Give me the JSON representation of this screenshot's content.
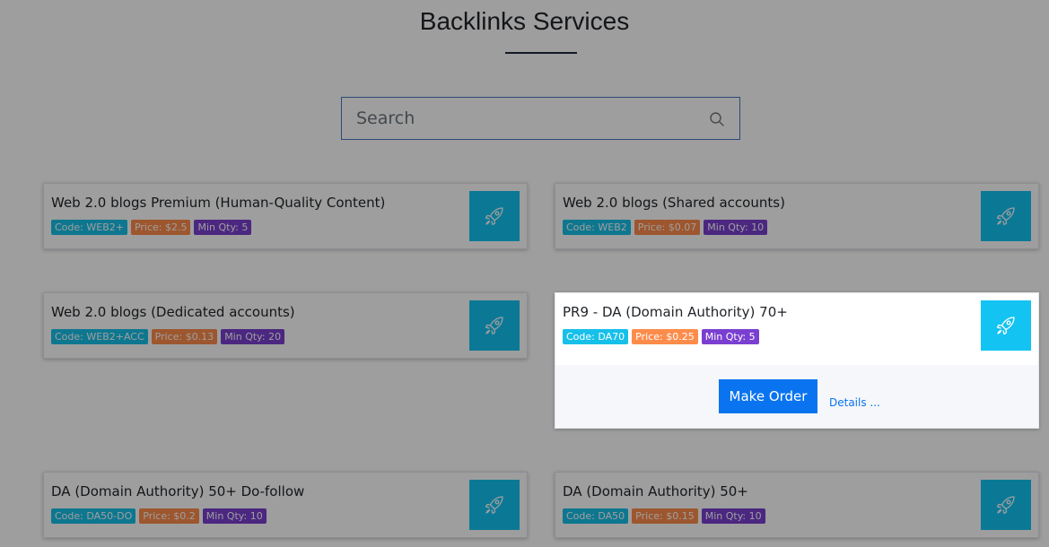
{
  "page": {
    "title": "Backlinks Services"
  },
  "search": {
    "placeholder": "Search",
    "icon": "search-icon"
  },
  "colors": {
    "code_badge": "#17c0e9",
    "price_badge": "#fd8c4b",
    "min_badge": "#7a3fd0",
    "rocket_button": "#13c3f2",
    "primary_button": "#0a74f0",
    "overlay": "rgba(0,0,0,0.38)"
  },
  "services": [
    {
      "name": "Web 2.0 blogs Premium (Human-Quality Content)",
      "code": "Code: WEB2+",
      "price": "Price: $2.5",
      "min_qty": "Min Qty: 5",
      "icon": "rocket-icon"
    },
    {
      "name": "Web 2.0 blogs (Shared accounts)",
      "code": "Code: WEB2",
      "price": "Price: $0.07",
      "min_qty": "Min Qty: 10",
      "icon": "rocket-icon"
    },
    {
      "name": "Web 2.0 blogs (Dedicated accounts)",
      "code": "Code: WEB2+ACC",
      "price": "Price: $0.13",
      "min_qty": "Min Qty: 20",
      "icon": "rocket-icon"
    },
    {
      "name": "PR9 - DA (Domain Authority) 70+",
      "code": "Code: DA70",
      "price": "Price: $0.25",
      "min_qty": "Min Qty: 5",
      "icon": "rocket-icon",
      "make_order_label": "Make Order",
      "details_label": "Details ..."
    },
    {
      "name": "DA (Domain Authority) 50+ Do-follow",
      "code": "Code: DA50-DO",
      "price": "Price: $0.2",
      "min_qty": "Min Qty: 10",
      "icon": "rocket-icon"
    },
    {
      "name": "DA (Domain Authority) 50+",
      "code": "Code: DA50",
      "price": "Price: $0.15",
      "min_qty": "Min Qty: 10",
      "icon": "rocket-icon"
    }
  ]
}
